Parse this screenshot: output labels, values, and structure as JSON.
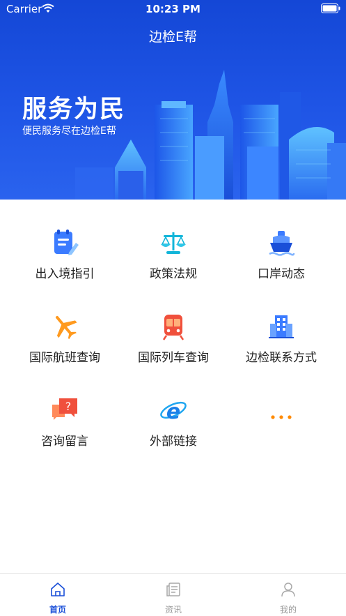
{
  "status_bar": {
    "carrier": "Carrier",
    "time": "10:23 PM"
  },
  "nav": {
    "title": "边检E帮"
  },
  "banner": {
    "slogan": "服务为民",
    "subtitle": "便民服务尽在边检E帮"
  },
  "menu": [
    {
      "label": "出入境指引",
      "icon": "guide-document-icon"
    },
    {
      "label": "政策法规",
      "icon": "scales-icon"
    },
    {
      "label": "口岸动态",
      "icon": "ship-icon"
    },
    {
      "label": "国际航班查询",
      "icon": "airplane-icon"
    },
    {
      "label": "国际列车查询",
      "icon": "train-icon"
    },
    {
      "label": "边检联系方式",
      "icon": "building-icon"
    },
    {
      "label": "咨询留言",
      "icon": "question-chat-icon"
    },
    {
      "label": "外部链接",
      "icon": "browser-e-icon"
    },
    {
      "label": "",
      "icon": "more-dots-icon"
    }
  ],
  "tabbar": [
    {
      "label": "首页",
      "icon": "home-icon",
      "active": true
    },
    {
      "label": "资讯",
      "icon": "news-icon",
      "active": false
    },
    {
      "label": "我的",
      "icon": "user-icon",
      "active": false
    }
  ],
  "colors": {
    "brand_blue": "#1a4fd8",
    "orange": "#ff8a00",
    "red": "#f0503c",
    "tab_inactive": "#999999"
  }
}
